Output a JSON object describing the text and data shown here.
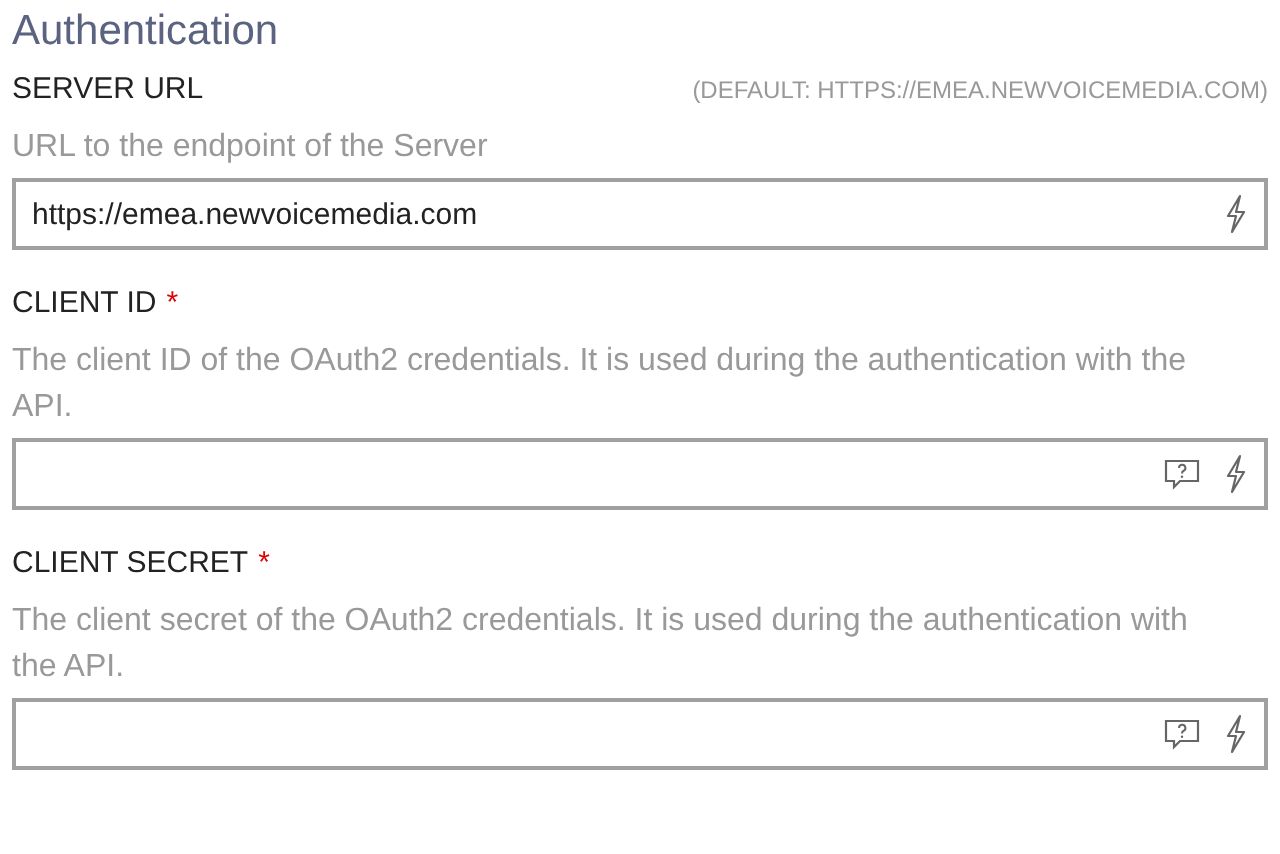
{
  "title": "Authentication",
  "fields": [
    {
      "label": "SERVER URL",
      "default": "(DEFAULT: HTTPS://EMEA.NEWVOICEMEDIA.COM)",
      "description": "URL to the endpoint of the Server",
      "value": "https://emea.newvoicemedia.com",
      "help_button": false
    },
    {
      "label": "CLIENT ID",
      "required_mark": "*",
      "description": "The client ID of the OAuth2 credentials. It is used during the authentication with the API.",
      "help_button": true
    },
    {
      "label": "CLIENT SECRET",
      "required_mark": "*",
      "description": "The client secret of the OAuth2 credentials. It is used during the authentication with the API.",
      "help_button": true
    }
  ]
}
